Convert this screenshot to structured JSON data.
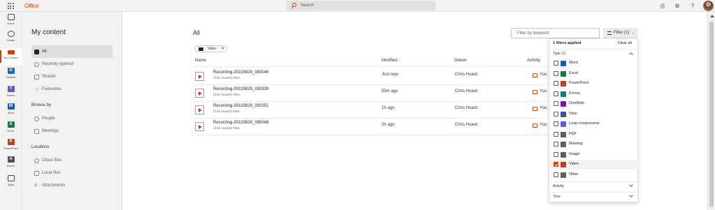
{
  "topbar": {
    "brand": "Office",
    "search_placeholder": "Search",
    "help_glyph": "?",
    "colors": {
      "brand": "#d83b01"
    }
  },
  "rail": [
    {
      "label": "Home",
      "icon": "home-icon"
    },
    {
      "label": "Create",
      "icon": "create-plus-icon"
    },
    {
      "label": "My Content",
      "icon": "folder-icon",
      "active": true
    },
    {
      "label": "Outlook",
      "icon": "outlook-icon",
      "glyph": "O",
      "color": "#0f6cbd"
    },
    {
      "label": "Teams",
      "icon": "teams-icon",
      "glyph": "T",
      "color": "#5b5fc7"
    },
    {
      "label": "Word",
      "icon": "word-icon",
      "glyph": "W",
      "color": "#185abd"
    },
    {
      "label": "Excel",
      "icon": "excel-icon",
      "glyph": "X",
      "color": "#107c41"
    },
    {
      "label": "PowerPoint",
      "icon": "powerpoint-icon",
      "glyph": "P",
      "color": "#c43e1c"
    },
    {
      "label": "Admin",
      "icon": "admin-icon",
      "glyph": "A",
      "color": "#505050"
    },
    {
      "label": "Apps",
      "icon": "apps-icon"
    }
  ],
  "leftnav": {
    "title": "My content",
    "items": [
      "All",
      "Recently opened",
      "Shared",
      "Favourites"
    ],
    "browse_heading": "Browse by",
    "browse_items": [
      "People",
      "Meetings"
    ],
    "locations_heading": "Locations",
    "location_items": [
      "Cloud files",
      "Local files",
      "Attachments"
    ]
  },
  "main": {
    "title": "All",
    "keyword_placeholder": "Filter by keyword",
    "filter_button": "Filter (1)",
    "chip_label": "Video",
    "chip_close": "✕",
    "columns": {
      "name": "Name",
      "modified": "Modified",
      "modified_sort": "↓",
      "owner": "Owner",
      "activity": "Activity"
    },
    "rows": [
      {
        "name": "Recording-20220829_083046",
        "location": "Chris Hoard's Files",
        "modified": "Just now",
        "owner": "Chris Hoard",
        "activity": "You"
      },
      {
        "name": "Recording-20220829_093339",
        "location": "Chris Hoard's Files",
        "modified": "55m ago",
        "owner": "Chris Hoard",
        "activity": "You"
      },
      {
        "name": "Recording-20220829_092351",
        "location": "Chris Hoard's Files",
        "modified": "1h ago",
        "owner": "Chris Hoard",
        "activity": "You"
      },
      {
        "name": "Recording-20220829_085048",
        "location": "Chris Hoard's Files",
        "modified": "2h ago",
        "owner": "Chris Hoard",
        "activity": "You"
      }
    ]
  },
  "filter_panel": {
    "applied_text": "1 filters applied",
    "clear_all": "Clear all",
    "type_heading": "Type (1)",
    "options": [
      {
        "label": "Word",
        "color": "#185abd",
        "checked": false
      },
      {
        "label": "Excel",
        "color": "#107c41",
        "checked": false
      },
      {
        "label": "PowerPoint",
        "color": "#c43e1c",
        "checked": false
      },
      {
        "label": "Forms",
        "color": "#038387",
        "checked": false
      },
      {
        "label": "OneNote",
        "color": "#7719aa",
        "checked": false
      },
      {
        "label": "Visio",
        "color": "#3955a3",
        "checked": false
      },
      {
        "label": "Loop components",
        "color": "#5e5ce6",
        "checked": false
      },
      {
        "label": "PDF",
        "color": "#605e5c",
        "checked": false
      },
      {
        "label": "Meeting",
        "color": "#605e5c",
        "checked": false
      },
      {
        "label": "Image",
        "color": "#605e5c",
        "checked": false
      },
      {
        "label": "Video",
        "color": "#c43e1c",
        "checked": true
      },
      {
        "label": "Other",
        "color": "#605e5c",
        "checked": false
      }
    ],
    "activity_heading": "Activity",
    "time_heading": "Time"
  }
}
